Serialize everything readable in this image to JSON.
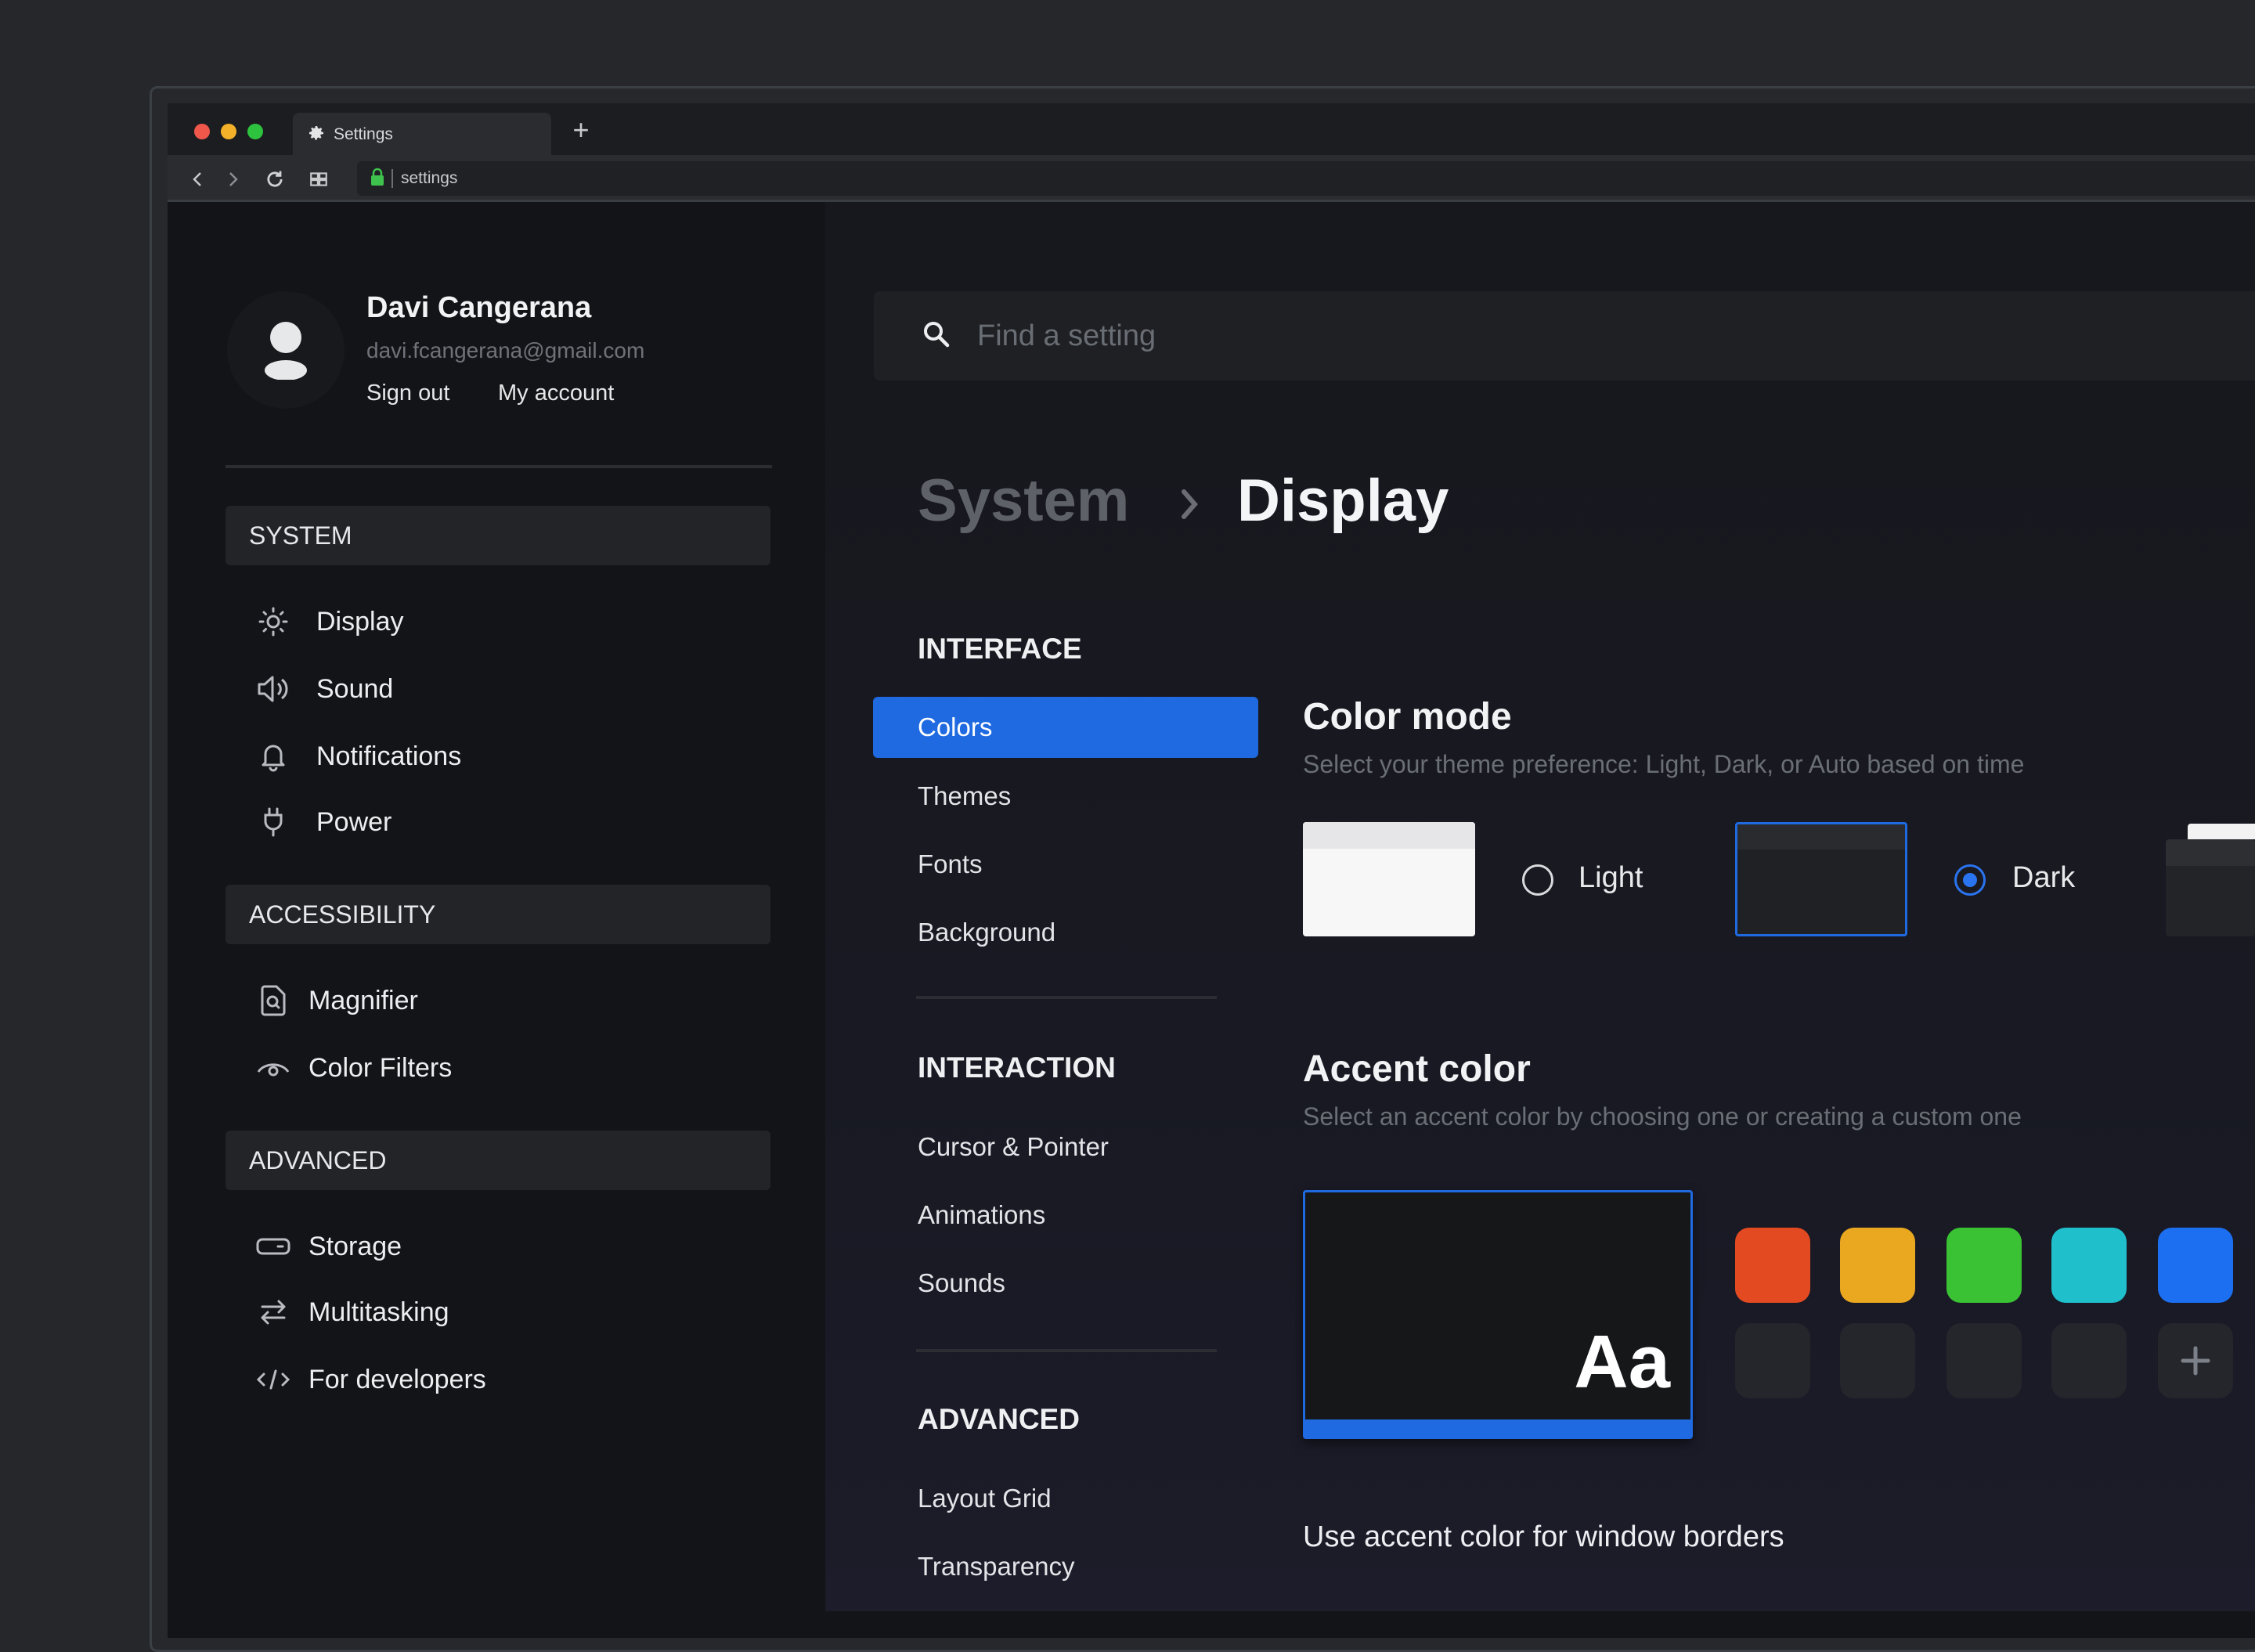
{
  "browser": {
    "tab_title": "Settings",
    "url": "settings",
    "new_tab_symbol": "+"
  },
  "user": {
    "name": "Davi Cangerana",
    "email": "davi.fcangerana@gmail.com",
    "sign_out": "Sign out",
    "my_account": "My account"
  },
  "sidebar": {
    "sections": [
      {
        "title": "SYSTEM",
        "items": [
          {
            "label": "Display",
            "icon": "brightness-icon"
          },
          {
            "label": "Sound",
            "icon": "speaker-icon"
          },
          {
            "label": "Notifications",
            "icon": "bell-icon"
          },
          {
            "label": "Power",
            "icon": "plug-icon"
          }
        ]
      },
      {
        "title": "ACCESSIBILITY",
        "items": [
          {
            "label": "Magnifier",
            "icon": "magnifier-icon"
          },
          {
            "label": "Color Filters",
            "icon": "eye-icon"
          }
        ]
      },
      {
        "title": "ADVANCED",
        "items": [
          {
            "label": "Storage",
            "icon": "storage-icon"
          },
          {
            "label": "Multitasking",
            "icon": "arrows-icon"
          },
          {
            "label": "For developers",
            "icon": "code-icon"
          }
        ]
      }
    ]
  },
  "search": {
    "placeholder": "Find a setting"
  },
  "breadcrumb": {
    "parent": "System",
    "current": "Display"
  },
  "subnav": {
    "groups": [
      {
        "title": "INTERFACE",
        "items": [
          "Colors",
          "Themes",
          "Fonts",
          "Background"
        ]
      },
      {
        "title": "INTERACTION",
        "items": [
          "Cursor & Pointer",
          "Animations",
          "Sounds"
        ]
      },
      {
        "title": "ADVANCED",
        "items": [
          "Layout Grid",
          "Transparency"
        ]
      }
    ],
    "active": "Colors"
  },
  "color_mode": {
    "title": "Color mode",
    "description": "Select your theme preference: Light, Dark, or Auto based on time",
    "options": [
      {
        "label": "Light",
        "selected": false
      },
      {
        "label": "Dark",
        "selected": true
      }
    ]
  },
  "accent": {
    "title": "Accent color",
    "description": "Select an accent color by choosing one or creating a custom one",
    "preview_text": "Aa",
    "selected_color": "#1f6ae0",
    "swatches": [
      "#e34a22",
      "#e9a81f",
      "#3ac234",
      "#1fc0cc",
      "#1c6ff0"
    ]
  },
  "options": {
    "window_borders": "Use accent color for window borders"
  }
}
